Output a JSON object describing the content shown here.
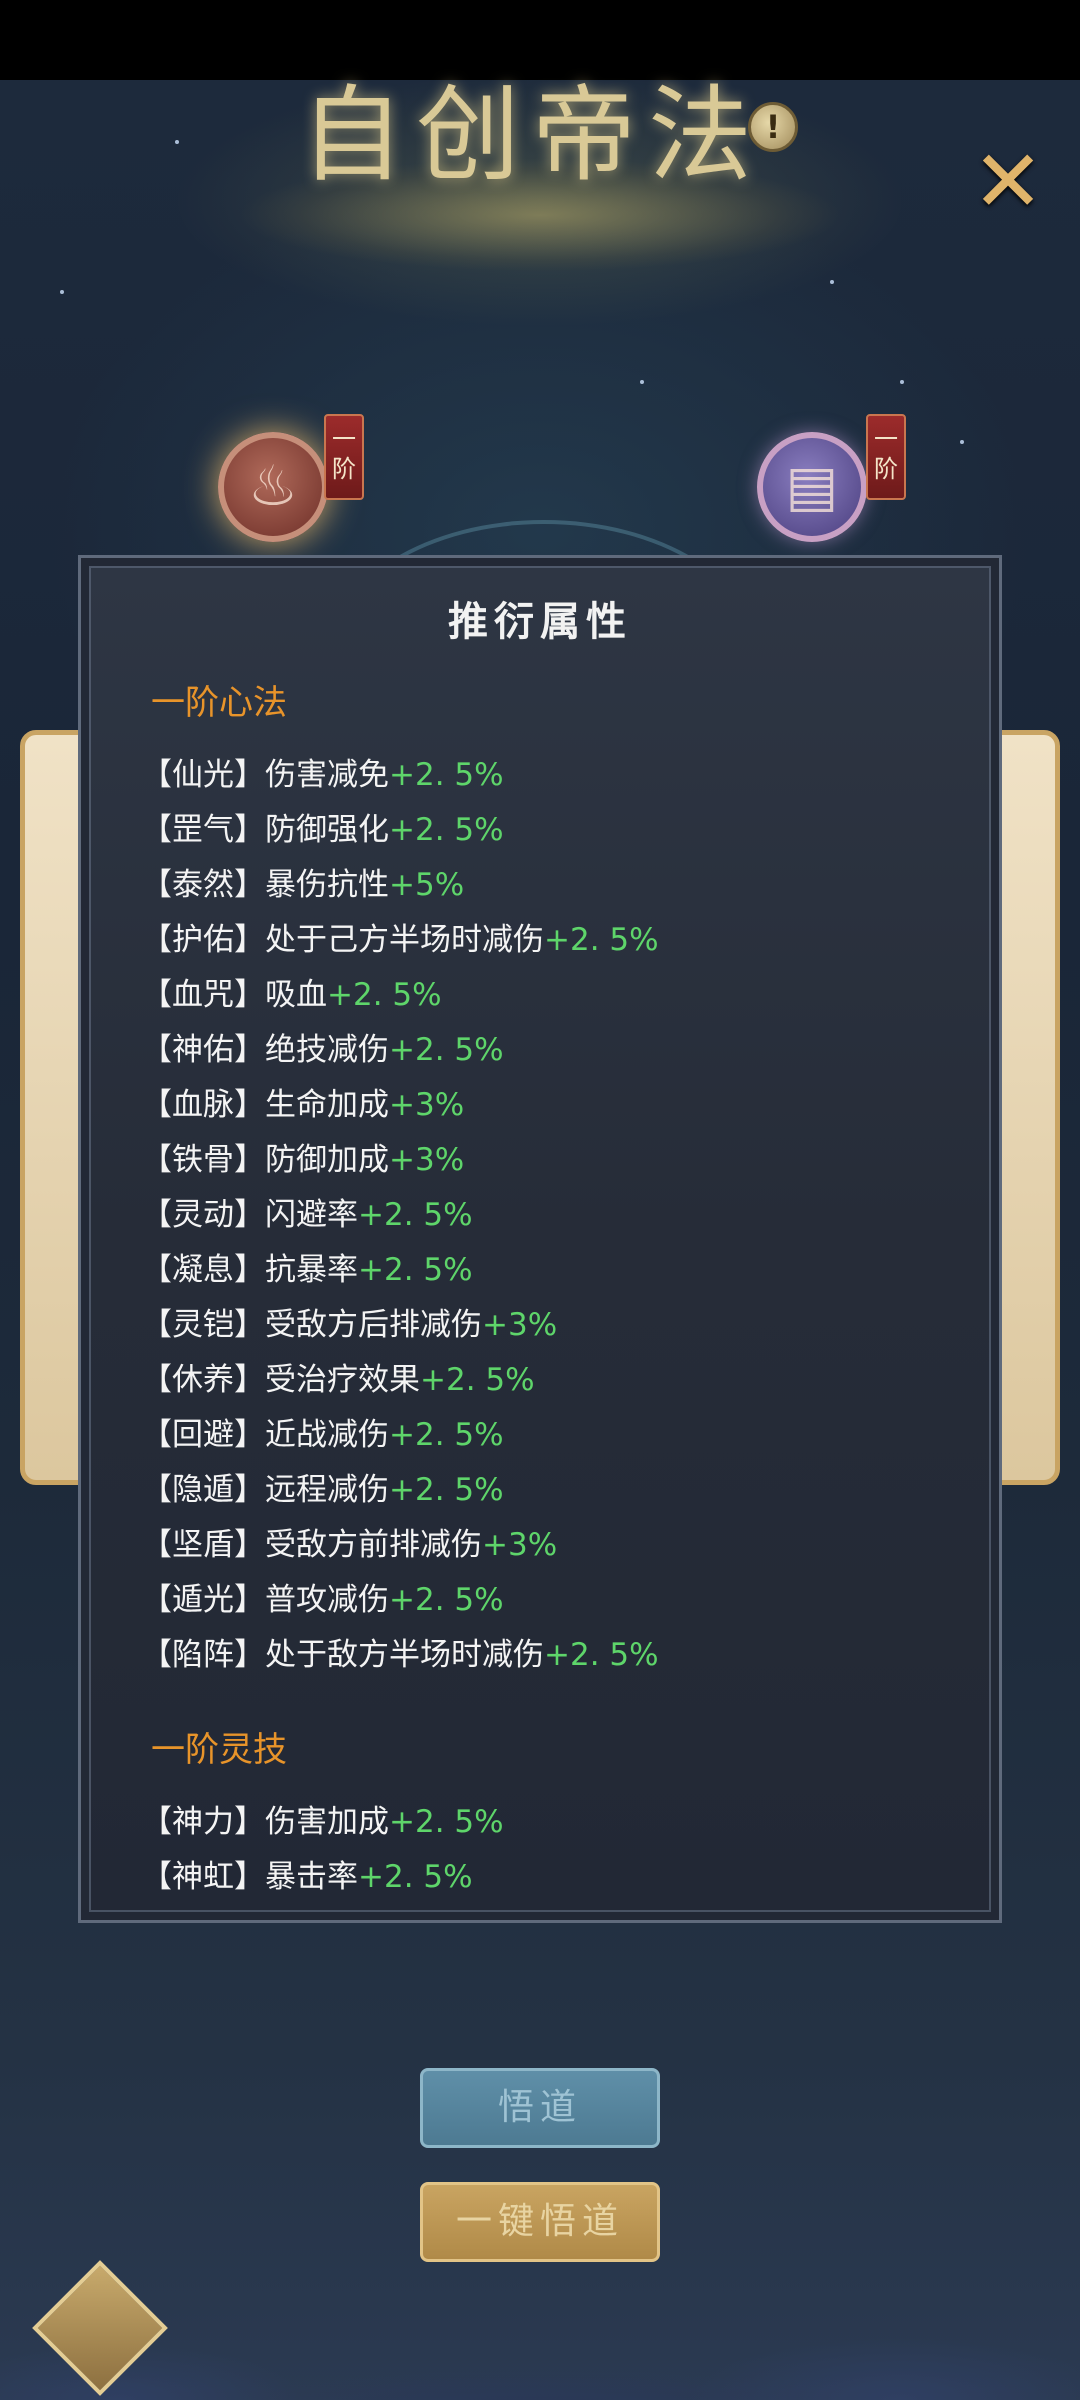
{
  "title": "自创帝法",
  "info_icon": "exclamation-icon",
  "close_icon": "close-x-icon",
  "skills": {
    "left": {
      "icon": "flame-heart-icon",
      "rank": "一阶"
    },
    "right": {
      "icon": "book-icon",
      "rank": "一阶"
    }
  },
  "panel": {
    "title": "推衍属性",
    "sections": [
      {
        "title": "一阶心法",
        "items": [
          {
            "name": "【仙光】",
            "desc": "伤害减免",
            "bonus": "+2. 5%"
          },
          {
            "name": "【罡气】",
            "desc": "防御强化",
            "bonus": "+2. 5%"
          },
          {
            "name": "【泰然】",
            "desc": "暴伤抗性",
            "bonus": "+5%"
          },
          {
            "name": "【护佑】",
            "desc": "处于己方半场时减伤",
            "bonus": "+2. 5%"
          },
          {
            "name": "【血咒】",
            "desc": "吸血",
            "bonus": "+2. 5%"
          },
          {
            "name": "【神佑】",
            "desc": "绝技减伤",
            "bonus": "+2. 5%"
          },
          {
            "name": "【血脉】",
            "desc": "生命加成",
            "bonus": "+3%"
          },
          {
            "name": "【铁骨】",
            "desc": "防御加成",
            "bonus": "+3%"
          },
          {
            "name": "【灵动】",
            "desc": "闪避率",
            "bonus": "+2. 5%"
          },
          {
            "name": "【凝息】",
            "desc": "抗暴率",
            "bonus": "+2. 5%"
          },
          {
            "name": "【灵铠】",
            "desc": "受敌方后排减伤",
            "bonus": "+3%"
          },
          {
            "name": "【休养】",
            "desc": "受治疗效果",
            "bonus": "+2. 5%"
          },
          {
            "name": "【回避】",
            "desc": "近战减伤",
            "bonus": "+2. 5%"
          },
          {
            "name": "【隐遁】",
            "desc": "远程减伤",
            "bonus": "+2. 5%"
          },
          {
            "name": "【坚盾】",
            "desc": "受敌方前排减伤",
            "bonus": "+3%"
          },
          {
            "name": "【遁光】",
            "desc": "普攻减伤",
            "bonus": "+2. 5%"
          },
          {
            "name": "【陷阵】",
            "desc": "处于敌方半场时减伤",
            "bonus": "+2. 5%"
          }
        ]
      },
      {
        "title": "一阶灵技",
        "items": [
          {
            "name": "【神力】",
            "desc": "伤害加成",
            "bonus": "+2. 5%"
          },
          {
            "name": "【神虹】",
            "desc": "暴击率",
            "bonus": "+2. 5%"
          }
        ]
      }
    ]
  },
  "buttons": {
    "wudao": "悟道",
    "yijian_wudao": "一键悟道"
  },
  "colors": {
    "section_title": "#e8942a",
    "bonus": "#5ed56a",
    "text": "#f4f4f4"
  }
}
